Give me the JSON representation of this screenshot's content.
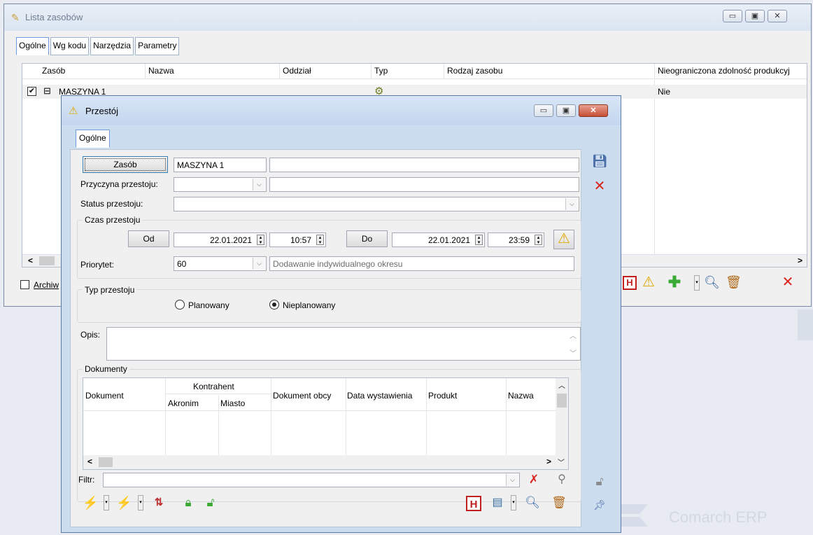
{
  "back_window": {
    "title": "Lista zasobów",
    "tabs": [
      "Ogólne",
      "Wg kodu",
      "Narzędzia",
      "Parametry"
    ],
    "columns": [
      "Zasób",
      "Nazwa",
      "Oddział",
      "Typ",
      "Rodzaj zasobu",
      "Nieograniczona zdolność produkcyj"
    ],
    "row": {
      "checked": "✔",
      "tree": "⊟",
      "zasob": "MASZYNA 1",
      "nieograniczona": "Nie"
    },
    "archive_label": "Archiw",
    "scroll_left": "<",
    "scroll_right": ">"
  },
  "dialog": {
    "title": "Przestój",
    "tab": "Ogólne",
    "zasob_button": "Zasób",
    "zasob_value": "MASZYNA 1",
    "zasob_name": "",
    "przyczyna_label": "Przyczyna przestoju:",
    "przyczyna_value": "",
    "status_label": "Status przestoju:",
    "status_value": "",
    "czas_group": "Czas przestoju",
    "od_button": "Od",
    "od_date": "22.01.2021",
    "od_time": "10:57",
    "do_button": "Do",
    "do_date": "22.01.2021",
    "do_time": "23:59",
    "priorytet_label": "Priorytet:",
    "priorytet_value": "60",
    "priorytet_note": "Dodawanie indywidualnego okresu",
    "typ_group": "Typ przestoju",
    "radio_planowany": "Planowany",
    "radio_nieplanowany": "Nieplanowany",
    "radio_selected": "Nieplanowany",
    "opis_label": "Opis:",
    "dokumenty_group": "Dokumenty",
    "doc_columns": {
      "dokument": "Dokument",
      "kontrahent": "Kontrahent",
      "akronim": "Akronim",
      "miasto": "Miasto",
      "dokument_obcy": "Dokument obcy",
      "data": "Data wystawienia",
      "produkt": "Produkt",
      "nazwa": "Nazwa"
    },
    "filtr_label": "Filtr:",
    "filtr_value": ""
  },
  "watermark": "Comarch ERP",
  "icons": {
    "save": "floppy-icon",
    "cancel": "close-x-icon",
    "warning": "warning-triangle-icon"
  },
  "colors": {
    "dialog_frame": "#cdddf0",
    "close_button": "#c54f36",
    "warning": "#f2c21a",
    "add_green": "#3aaa35"
  }
}
